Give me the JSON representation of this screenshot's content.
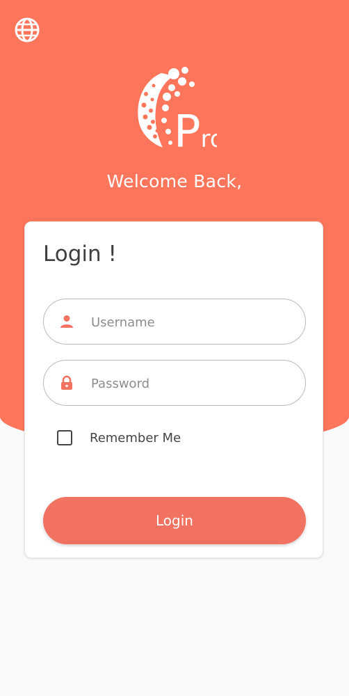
{
  "header": {
    "language_icon": "globe-icon",
    "logo_text": "Pro",
    "welcome_text": "Welcome Back,"
  },
  "login_card": {
    "title": "Login !",
    "username": {
      "placeholder": "Username",
      "value": "",
      "icon": "user-icon"
    },
    "password": {
      "placeholder": "Password",
      "value": "",
      "icon": "lock-icon"
    },
    "remember_label": "Remember Me",
    "remember_checked": false,
    "login_label": "Login"
  },
  "colors": {
    "brand": "#fd755a",
    "button": "#f27261",
    "background": "#f9fafc",
    "card": "#ffffff"
  }
}
